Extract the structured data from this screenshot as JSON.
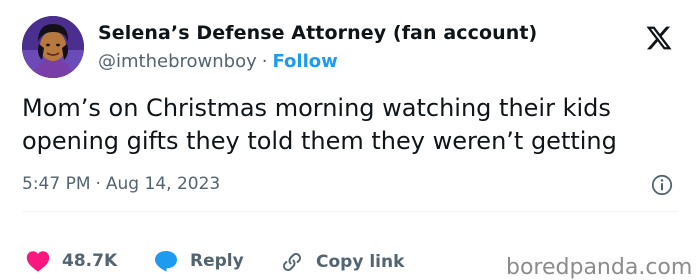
{
  "author": {
    "display_name": "Selena’s Defense Attorney (fan account)",
    "handle": "@imthebrownboy",
    "separator": "·",
    "follow_label": "Follow",
    "avatar_icon": "avatar-illustration"
  },
  "brand": {
    "logo_icon": "x-logo-icon"
  },
  "tweet": {
    "text": "Mom’s on Christmas morning watching their kids\nopening gifts they told them they weren’t getting",
    "time": "5:47 PM",
    "date": "Aug 14, 2023",
    "separator": "·",
    "info_icon": "info-icon"
  },
  "actions": {
    "likes_count": "48.7K",
    "reply_label": "Reply",
    "copy_link_label": "Copy link"
  },
  "watermark": {
    "text": "boredpanda.com"
  },
  "colors": {
    "like_red": "#f91880",
    "reply_blue": "#1d9bf0",
    "follow_blue": "#1d9bf0",
    "secondary_text": "#536471",
    "primary_text": "#0f1419"
  }
}
